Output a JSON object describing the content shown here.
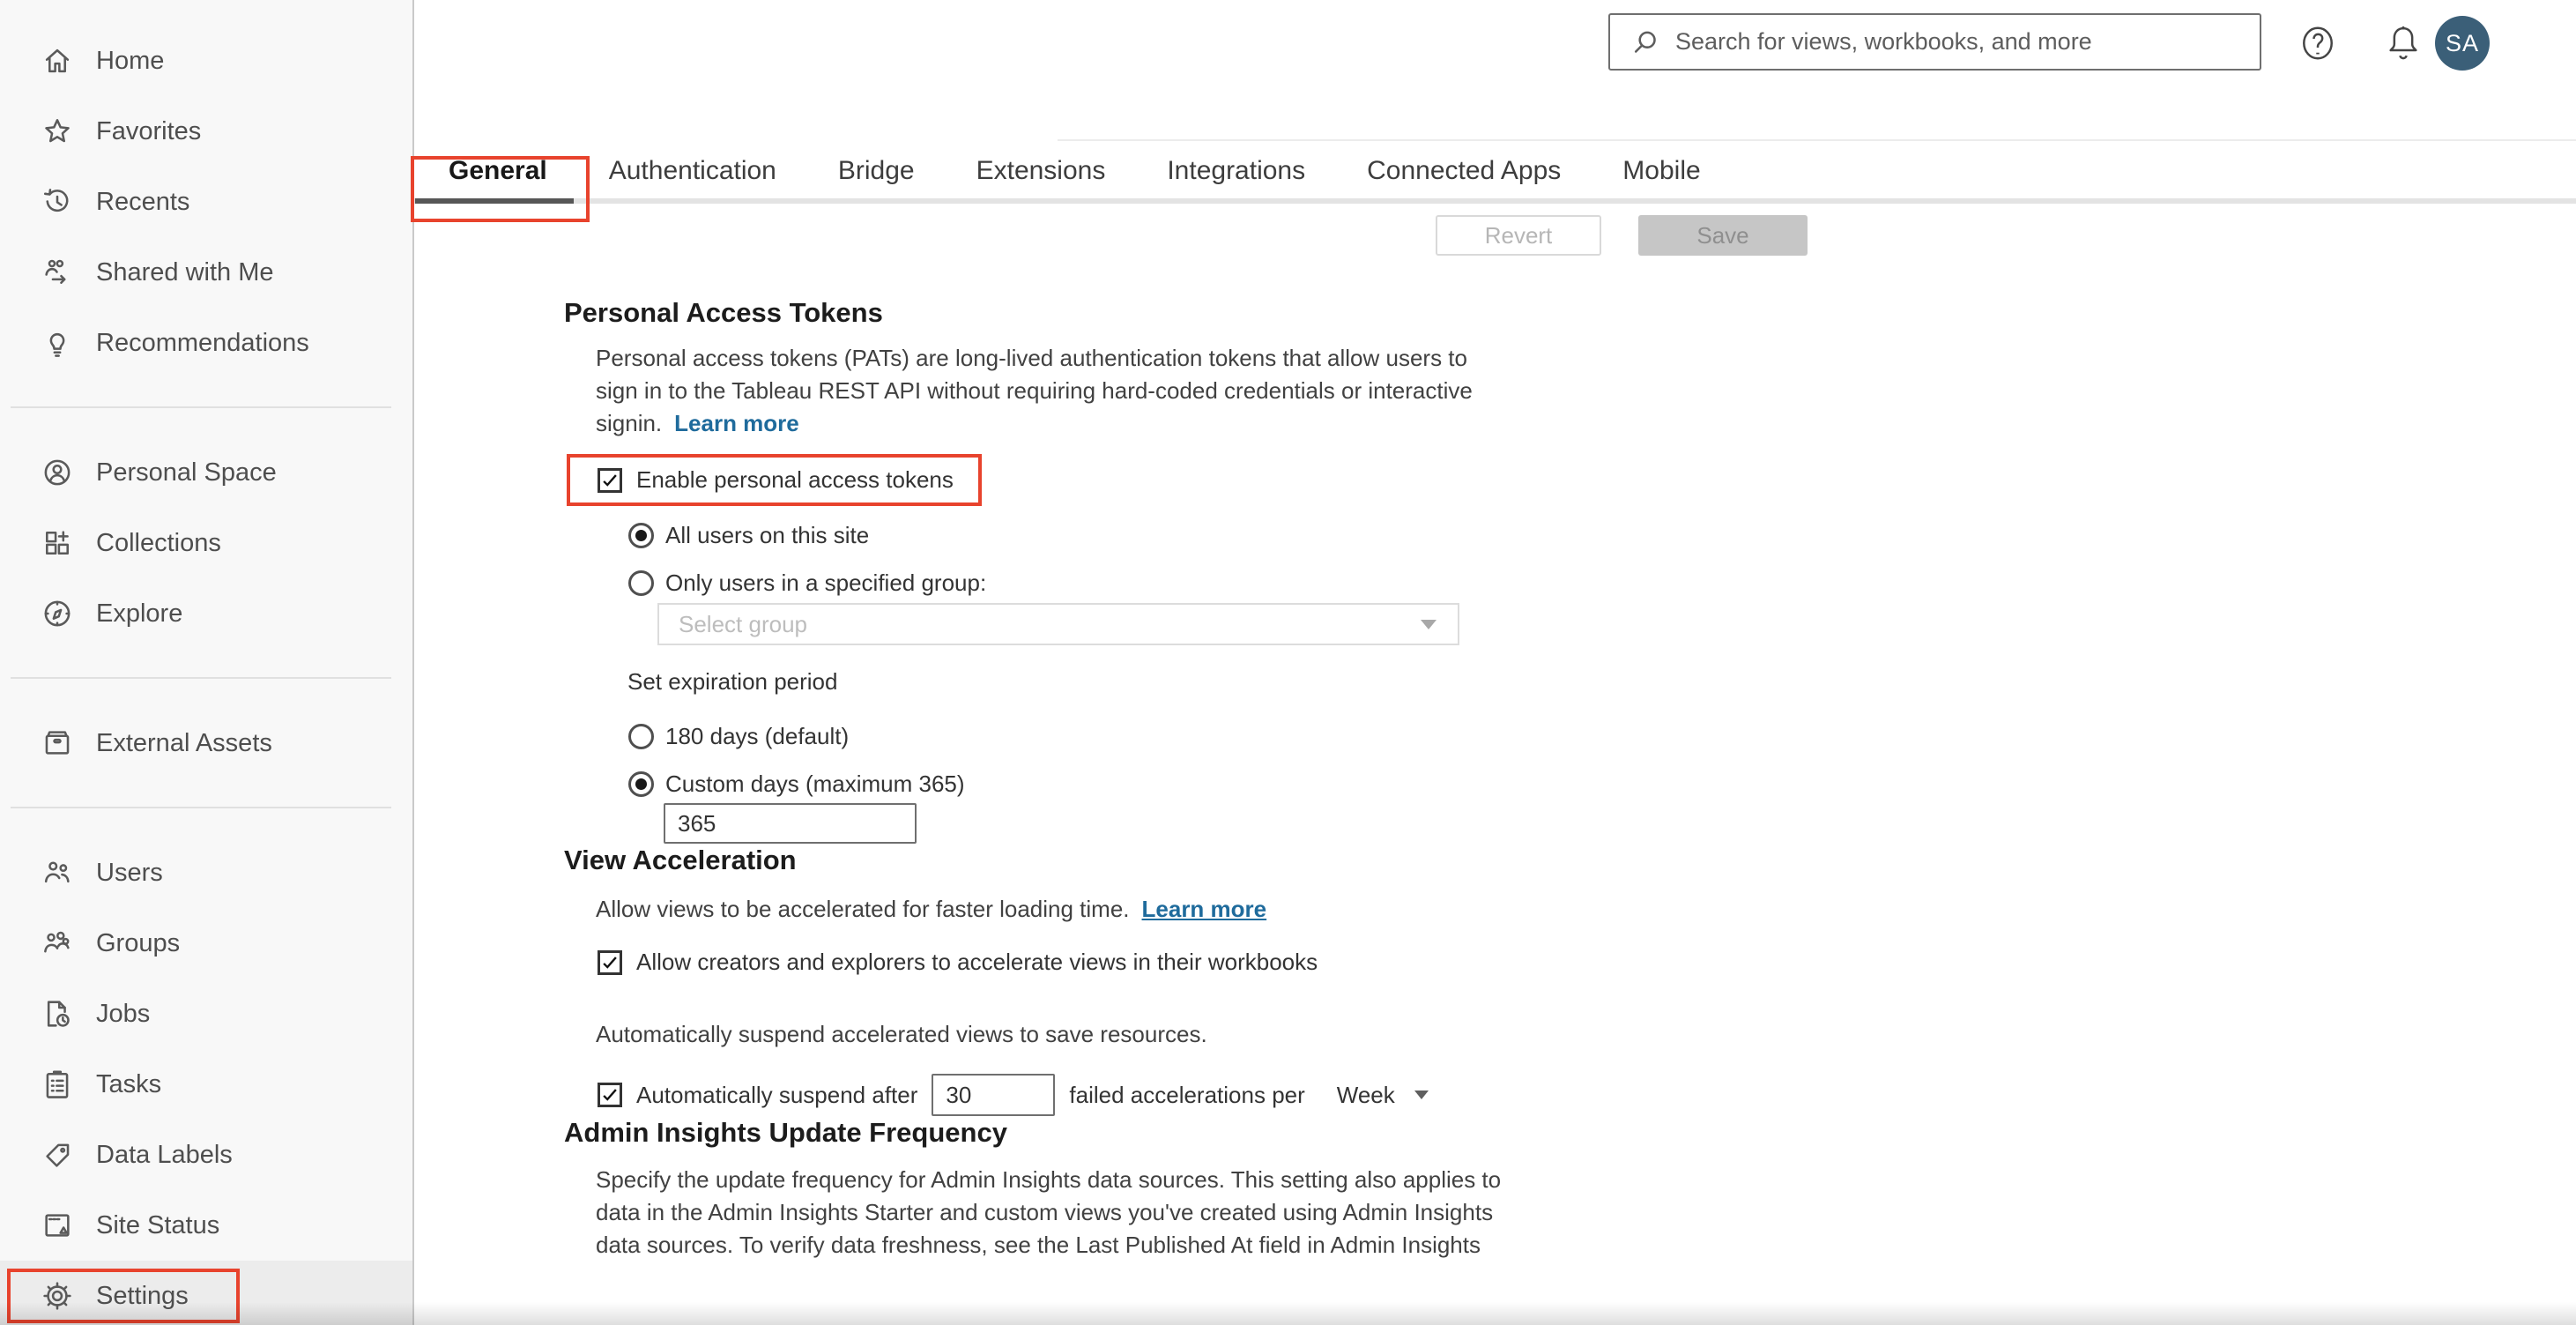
{
  "header": {
    "search_placeholder": "Search for views, workbooks, and more",
    "help_icon": "help-circle-icon",
    "notifications_icon": "bell-icon",
    "avatar_initials": "SA"
  },
  "sidebar": {
    "items": [
      {
        "label": "Home",
        "icon": "home-icon"
      },
      {
        "label": "Favorites",
        "icon": "star-icon"
      },
      {
        "label": "Recents",
        "icon": "history-icon"
      },
      {
        "label": "Shared with Me",
        "icon": "shared-icon"
      },
      {
        "label": "Recommendations",
        "icon": "lightbulb-icon"
      },
      {
        "divider": true
      },
      {
        "label": "Personal Space",
        "icon": "person-circle-icon"
      },
      {
        "label": "Collections",
        "icon": "collections-icon"
      },
      {
        "label": "Explore",
        "icon": "compass-icon"
      },
      {
        "divider": true
      },
      {
        "label": "External Assets",
        "icon": "drawer-icon"
      },
      {
        "divider": true
      },
      {
        "label": "Users",
        "icon": "users-icon"
      },
      {
        "label": "Groups",
        "icon": "groups-icon"
      },
      {
        "label": "Jobs",
        "icon": "jobs-icon"
      },
      {
        "label": "Tasks",
        "icon": "tasks-icon"
      },
      {
        "label": "Data Labels",
        "icon": "tag-icon"
      },
      {
        "label": "Site Status",
        "icon": "site-status-icon"
      },
      {
        "label": "Settings",
        "icon": "gear-icon",
        "selected": true,
        "annotated": true
      }
    ]
  },
  "tabs": {
    "items": [
      {
        "label": "General",
        "selected": true,
        "annotated": true
      },
      {
        "label": "Authentication"
      },
      {
        "label": "Bridge"
      },
      {
        "label": "Extensions"
      },
      {
        "label": "Integrations"
      },
      {
        "label": "Connected Apps"
      },
      {
        "label": "Mobile"
      }
    ]
  },
  "toolbar": {
    "revert_label": "Revert",
    "save_label": "Save"
  },
  "sections": {
    "pat": {
      "title": "Personal Access Tokens",
      "description": "Personal access tokens (PATs) are long-lived authentication tokens that allow users to\nsign in to the Tableau REST API without requiring hard-coded credentials or interactive\nsignin.",
      "learn_more": "Learn more",
      "enable_label": "Enable personal access tokens",
      "enable_checked": true,
      "scope_all_label": "All users on this site",
      "scope_group_label": "Only users in a specified group:",
      "scope_selected": "all",
      "group_placeholder": "Select group",
      "expiration_label": "Set expiration period",
      "expiration_default_label": "180 days (default)",
      "expiration_custom_label": "Custom days (maximum 365)",
      "expiration_selected": "custom",
      "custom_days_value": "365"
    },
    "view_acceleration": {
      "title": "View Acceleration",
      "description": "Allow views to be accelerated for faster loading time.",
      "learn_more": "Learn more",
      "allow_label": "Allow creators and explorers to accelerate views in their workbooks",
      "allow_checked": true,
      "suspend_description": "Automatically suspend accelerated views to save resources.",
      "suspend_checked": true,
      "suspend_before_label": "Automatically suspend after",
      "suspend_value": "30",
      "suspend_after_label": "failed accelerations per",
      "suspend_period_value": "Week"
    },
    "admin_insights": {
      "title": "Admin Insights Update Frequency",
      "description": "Specify the update frequency for Admin Insights data sources. This setting also applies to\ndata in the Admin Insights Starter and custom views you've created using Admin Insights\ndata sources. To verify data freshness, see the Last Published At field in Admin Insights"
    }
  },
  "colors": {
    "annotation_red": "#e8432d",
    "link_blue": "#1f6b9c",
    "avatar_bg": "#3b5f78",
    "active_tab_underline": "#575757"
  }
}
